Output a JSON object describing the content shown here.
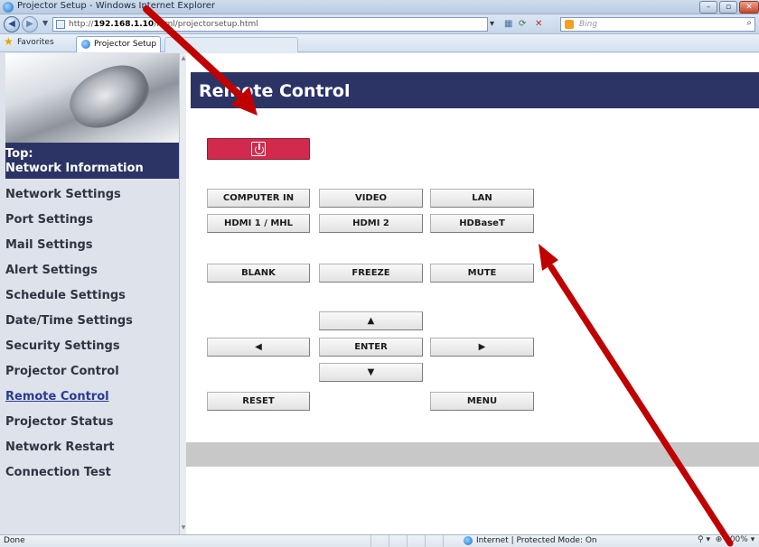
{
  "browser": {
    "window_title": "Projector Setup - Windows Internet Explorer",
    "address_prefix": "http://",
    "address_host": "192.168.1.10",
    "address_path": "/html/projectorsetup.html",
    "search_placeholder": "Bing",
    "favorites_label": "Favorites",
    "tab_label": "Projector Setup",
    "status_text": "Done",
    "zone_text": "Internet | Protected Mode: On",
    "zoom_text": "100%"
  },
  "sidebar": {
    "top_line1": "Top:",
    "top_line2": "Network Information",
    "items": [
      {
        "label": "Network Settings"
      },
      {
        "label": "Port Settings"
      },
      {
        "label": "Mail Settings"
      },
      {
        "label": "Alert Settings"
      },
      {
        "label": "Schedule Settings"
      },
      {
        "label": "Date/Time Settings"
      },
      {
        "label": "Security Settings"
      },
      {
        "label": "Projector Control"
      },
      {
        "label": "Remote Control"
      },
      {
        "label": "Projector Status"
      },
      {
        "label": "Network Restart"
      },
      {
        "label": "Connection Test"
      }
    ],
    "active_item": "Remote Control"
  },
  "main": {
    "title": "Remote Control",
    "buttons": {
      "computer_in": "COMPUTER IN",
      "video": "VIDEO",
      "lan": "LAN",
      "hdmi1": "HDMI 1 / MHL",
      "hdmi2": "HDMI 2",
      "hdbaset": "HDBaseT",
      "blank": "BLANK",
      "freeze": "FREEZE",
      "mute": "MUTE",
      "up": "▲",
      "left": "◀",
      "enter": "ENTER",
      "right": "▶",
      "down": "▼",
      "reset": "RESET",
      "menu": "MENU"
    }
  },
  "colors": {
    "header_navy": "#2c3466",
    "power_red": "#d12a4d",
    "arrow_red": "#c00000",
    "active_link": "#2b3b8c"
  }
}
